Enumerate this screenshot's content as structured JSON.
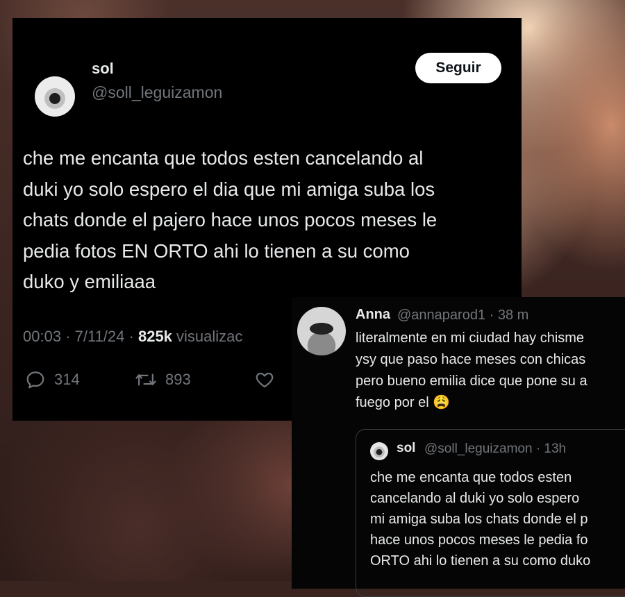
{
  "tweet": {
    "author_name": "sol",
    "author_handle": "@soll_leguizamon",
    "follow_label": "Seguir",
    "text_lines": [
      "che me encanta que todos esten cancelando al",
      "duki yo solo espero el dia que mi amiga suba los",
      "chats donde el pajero hace unos pocos meses le",
      "pedia fotos EN ORTO ahi lo tienen a su como",
      "duko y emiliaaa"
    ],
    "time": "00:03",
    "date": "7/11/24",
    "views_count": "825k",
    "views_label": "visualizac",
    "replies": "314",
    "retweets": "893"
  },
  "reply": {
    "author_name": "Anna",
    "author_meta": "@annaparod1 · 38 m",
    "text_lines": [
      "literalmente en mi ciudad hay chisme",
      "ysy que paso hace meses con chicas",
      "pero bueno emilia dice que pone su a",
      "fuego por el 😩"
    ],
    "quoted": {
      "author_name": "sol",
      "author_meta": "@soll_leguizamon · 13h",
      "text_lines": [
        "che me encanta que todos esten",
        "cancelando al duki yo solo espero",
        "mi amiga suba los chats donde el p",
        "hace unos pocos meses le pedia fo",
        "ORTO ahi lo tienen a su como duko"
      ]
    }
  },
  "colors": {
    "card_bg": "#000000",
    "text": "#e7e9ea",
    "secondary_text": "#71767b",
    "follow_bg": "#ffffff"
  },
  "icons": [
    "reply-icon",
    "retweet-icon",
    "like-icon"
  ]
}
